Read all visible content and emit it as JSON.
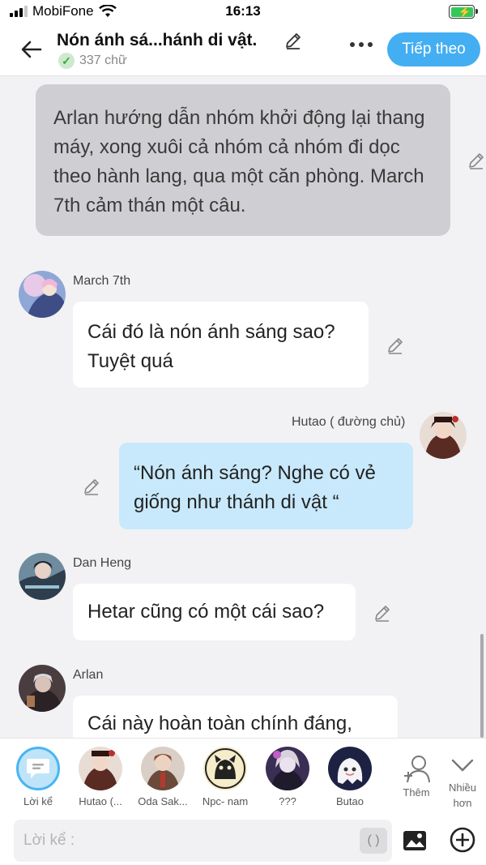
{
  "status_bar": {
    "carrier": "MobiFone",
    "time": "16:13"
  },
  "header": {
    "title": "Nón ánh sá...hánh di vật.",
    "word_count": "337 chữ",
    "next_label": "Tiếp theo"
  },
  "messages": [
    {
      "type": "narration",
      "text": "Arlan hướng dẫn nhóm khởi động lại thang máy, xong xuôi cả nhóm cả nhóm đi dọc theo hành lang, qua một căn phòng. March 7th cảm thán một câu."
    },
    {
      "type": "left",
      "sender": "March 7th",
      "text": "Cái đó là nón ánh sáng sao? Tuyệt quá"
    },
    {
      "type": "right",
      "sender": "Hutao ( đường chủ)",
      "text": "“Nón ánh sáng? Nghe có vẻ giống như thánh di vật “"
    },
    {
      "type": "left",
      "sender": "Dan Heng",
      "text": "Hetar cũng có một cái sao?"
    },
    {
      "type": "left",
      "sender": "Arlan",
      "text": "Cái này hoàn toàn chính đáng,"
    }
  ],
  "characters": [
    {
      "label": "Lời kể"
    },
    {
      "label": "Hutao (..."
    },
    {
      "label": "Oda Sak..."
    },
    {
      "label": "Npc- nam"
    },
    {
      "label": "???"
    },
    {
      "label": "Butao"
    }
  ],
  "actions": {
    "add_label": "Thêm",
    "more_label": "Nhiều hơn"
  },
  "input": {
    "placeholder": "Lời kể :",
    "paren": "( )"
  },
  "colors": {
    "accent": "#44aef2",
    "my_bubble": "#c8e9fb",
    "narration_bg": "#cfcfd3"
  }
}
